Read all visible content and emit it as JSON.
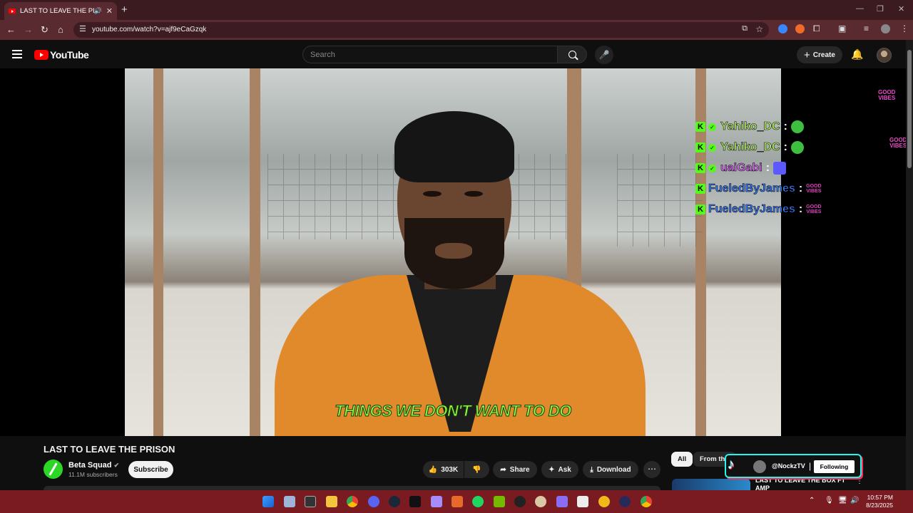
{
  "browser": {
    "tab_title": "LAST TO LEAVE THE PRISON",
    "url": "youtube.com/watch?v=ajf9eCaGzqk"
  },
  "youtube": {
    "logo_text": "YouTube",
    "search_placeholder": "Search",
    "create_label": "Create"
  },
  "video": {
    "subtitle": "THINGS WE DON'T WANT TO DO",
    "title": "LAST TO LEAVE THE PRISON"
  },
  "chat": [
    {
      "user": "Yahiko_DC",
      "color": "#b6f56a",
      "verified": true
    },
    {
      "user": "Yahiko_DC",
      "color": "#b6f56a",
      "verified": true
    },
    {
      "user": "uaiGabi",
      "color": "#e46cff",
      "verified": true
    },
    {
      "user": "FueledByJames",
      "color": "#3b7dff",
      "verified": false
    },
    {
      "user": "FueledByJames",
      "color": "#3b7dff",
      "verified": false
    }
  ],
  "channel": {
    "name": "Beta Squad",
    "subscribers": "11.1M subscribers",
    "subscribe_label": "Subscribe"
  },
  "actions": {
    "likes": "303K",
    "share": "Share",
    "ask": "Ask",
    "download": "Download"
  },
  "chips": {
    "all": "All",
    "from_series": "From the se"
  },
  "tiktok": {
    "handle": "@NockzTV",
    "following": "Following"
  },
  "up_next": {
    "title": "LAST TO LEAVE THE BOX FT AMP"
  },
  "overlay": {
    "good_vibes_top": "GOOD",
    "good_vibes_bottom": "VIBES"
  },
  "taskbar": {
    "time": "10:57 PM",
    "date": "8/23/2025"
  },
  "colors": {
    "youtube_red": "#ff0000",
    "kick_green": "#53fc18",
    "subtitle_green": "#8cf544",
    "taskbar": "#7a1b22"
  }
}
